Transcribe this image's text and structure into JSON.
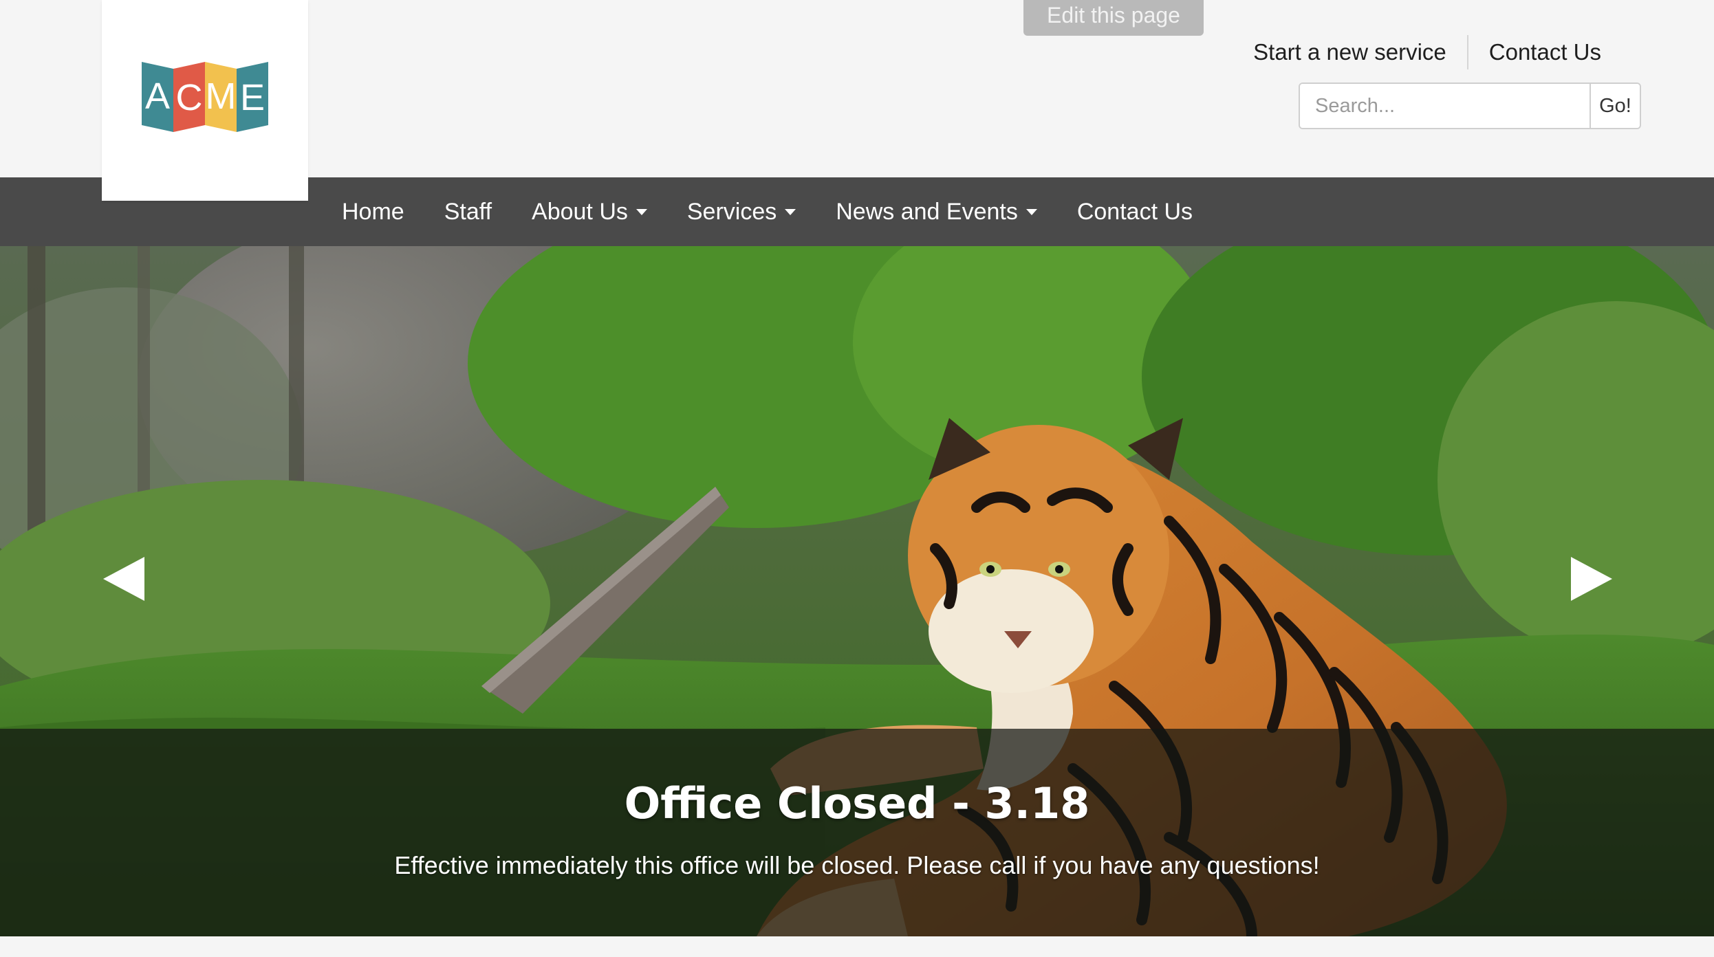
{
  "header": {
    "logo": {
      "letters": [
        "A",
        "C",
        "M",
        "E"
      ],
      "colors": [
        "#3f8a93",
        "#e05a47",
        "#f2c14e",
        "#3f8a93"
      ]
    },
    "edit_button": "Edit this page",
    "top_links": [
      "Start a new service",
      "Contact Us"
    ],
    "search": {
      "placeholder": "Search...",
      "button": "Go!"
    }
  },
  "nav": {
    "items": [
      {
        "label": "Home",
        "dropdown": false
      },
      {
        "label": "Staff",
        "dropdown": false
      },
      {
        "label": "About Us",
        "dropdown": true
      },
      {
        "label": "Services",
        "dropdown": true
      },
      {
        "label": "News and Events",
        "dropdown": true
      },
      {
        "label": "Contact Us",
        "dropdown": false
      }
    ]
  },
  "hero": {
    "image_icon": "tiger-photo",
    "title": "Office Closed - 3.18",
    "text": "Effective immediately this office will be closed. Please call if you have any questions!",
    "prev_icon": "arrow-left-icon",
    "next_icon": "arrow-right-icon"
  },
  "colors": {
    "navbar": "#4a4a4a",
    "page_bg": "#f5f5f5"
  }
}
